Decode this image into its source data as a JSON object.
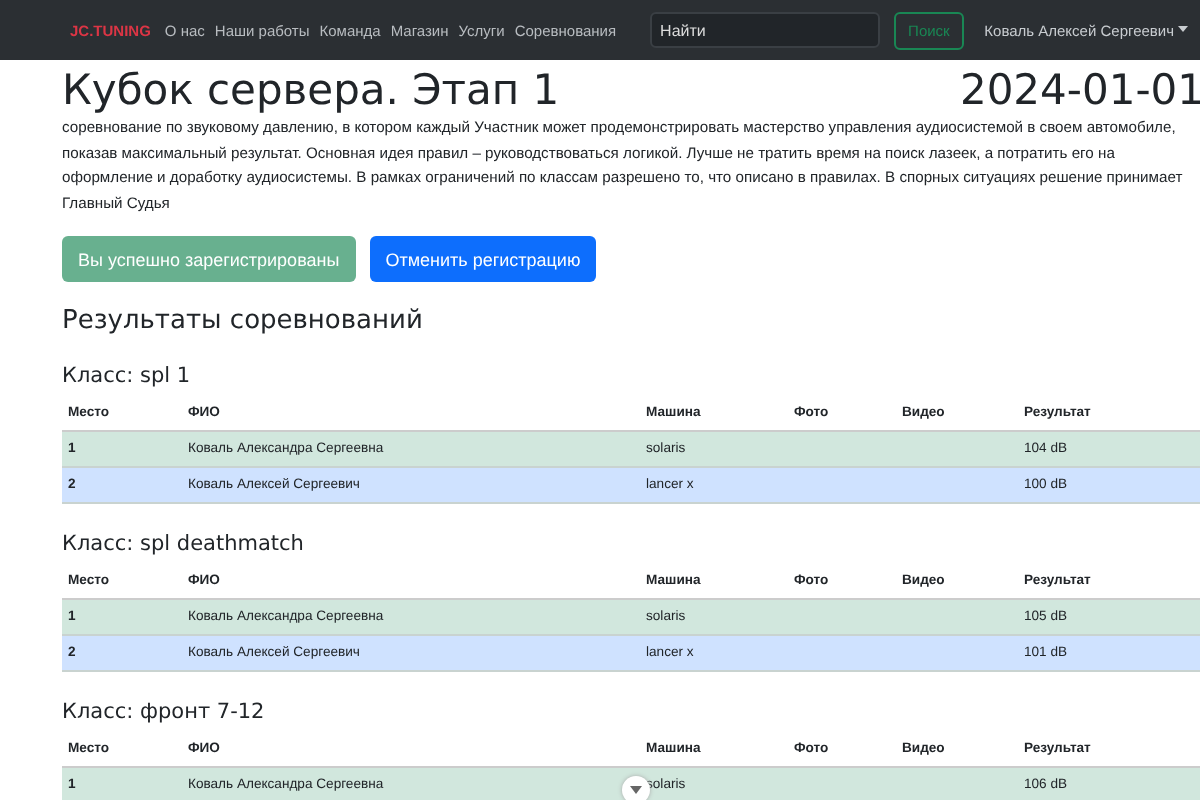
{
  "navbar": {
    "brand": "JC.TUNING",
    "links": [
      "О нас",
      "Наши работы",
      "Команда",
      "Магазин",
      "Услуги",
      "Соревнования"
    ],
    "search": {
      "placeholder": "Найти"
    },
    "search_button": "Поиск",
    "user": "Коваль Алексей Сергеевич"
  },
  "event": {
    "title": "Кубок сервера. Этап 1",
    "date": "2024-01-01",
    "description": "соревнование по звуковому давлению, в котором каждый Участник может продемонстрировать мастерство управления аудиосистемой в своем автомобиле, показав максимальный результат. Основная идея правил – руководствоваться логикой. Лучше не тратить время на поиск лазеек, а потратить его на оформление и доработку аудиосистемы. В рамках ограничений по классам разрешено то, что описано в правилах. В спорных ситуациях решение принимает Главный Судья"
  },
  "buttons": [
    {
      "label": "Вы успешно зарегистрированы",
      "kind": "success",
      "disabled": true
    },
    {
      "label": "Отменить регистрацию",
      "kind": "primary",
      "disabled": false
    }
  ],
  "results_title": "Результаты соревнований",
  "classes": [
    {
      "title": "Класс: spl 1",
      "columns": [
        "Место",
        "ФИО",
        "Машина",
        "Фото",
        "Видео",
        "Результат"
      ],
      "rows": [
        {
          "kind": "success",
          "place": "1",
          "name": "Коваль Александра Сергеевна",
          "car": "solaris",
          "result": "104 dB"
        },
        {
          "kind": "primary",
          "place": "2",
          "name": "Коваль Алексей Сергеевич",
          "car": "lancer x",
          "result": "100 dB"
        }
      ]
    },
    {
      "title": "Класс: spl deathmatch",
      "columns": [
        "Место",
        "ФИО",
        "Машина",
        "Фото",
        "Видео",
        "Результат"
      ],
      "rows": [
        {
          "kind": "success",
          "place": "1",
          "name": "Коваль Александра Сергеевна",
          "car": "solaris",
          "result": "105 dB"
        },
        {
          "kind": "primary",
          "place": "2",
          "name": "Коваль Алексей Сергеевич",
          "car": "lancer x",
          "result": "101 dB"
        }
      ]
    },
    {
      "title": "Класс: фронт 7-12",
      "columns": [
        "Место",
        "ФИО",
        "Машина",
        "Фото",
        "Видео",
        "Результат"
      ],
      "rows": [
        {
          "kind": "success",
          "place": "1",
          "name": "Коваль Александра Сергеевна",
          "car": "solaris",
          "result": "106 dB"
        }
      ]
    }
  ]
}
